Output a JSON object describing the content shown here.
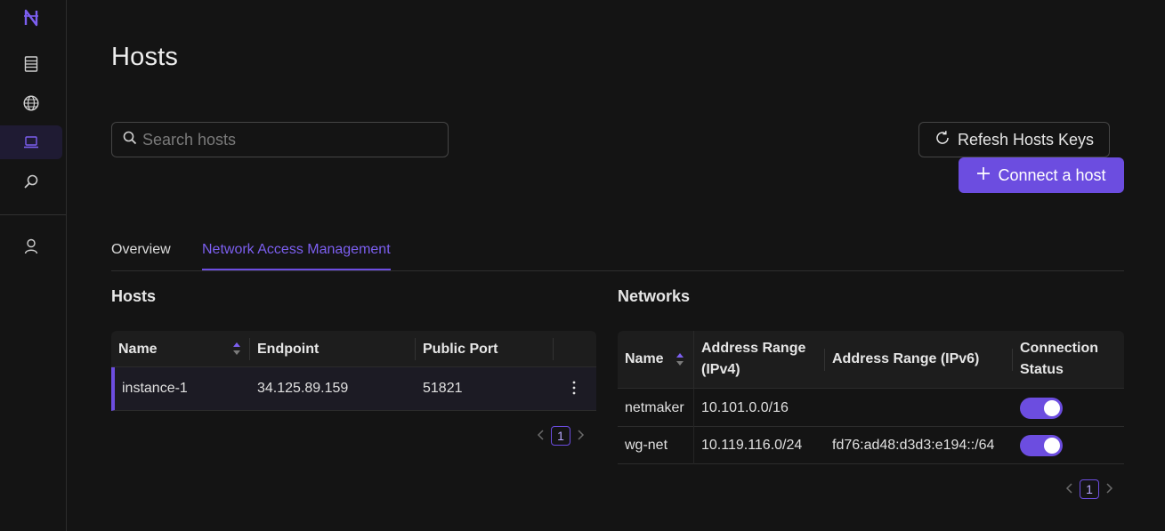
{
  "sidebar": {
    "logo": "netmaker-logo-icon",
    "items": [
      {
        "name": "networks",
        "icon": "server-icon"
      },
      {
        "name": "globe",
        "icon": "globe-icon"
      },
      {
        "name": "hosts",
        "icon": "laptop-icon",
        "active": true
      },
      {
        "name": "search",
        "icon": "search-icon"
      },
      {
        "name": "user",
        "icon": "user-icon"
      }
    ]
  },
  "page": {
    "title": "Hosts"
  },
  "search": {
    "placeholder": "Search hosts",
    "value": ""
  },
  "buttons": {
    "refresh_label": "Refesh Hosts Keys",
    "connect_label": "Connect a host"
  },
  "tabs": [
    {
      "label": "Overview",
      "active": false
    },
    {
      "label": "Network Access Management",
      "active": true
    }
  ],
  "hosts_section": {
    "title": "Hosts",
    "columns": [
      "Name",
      "Endpoint",
      "Public Port"
    ],
    "rows": [
      {
        "name": "instance-1",
        "endpoint": "34.125.89.159",
        "port": "51821"
      }
    ],
    "page": "1"
  },
  "networks_section": {
    "title": "Networks",
    "columns": {
      "name": "Name",
      "ipv4_line1": "Address Range",
      "ipv4_line2": "(IPv4)",
      "ipv6": "Address Range (IPv6)",
      "status_line1": "Connection",
      "status_line2": "Status"
    },
    "rows": [
      {
        "name": "netmaker",
        "ipv4": "10.101.0.0/16",
        "ipv6": "",
        "connected": true
      },
      {
        "name": "wg-net",
        "ipv4": "10.119.116.0/24",
        "ipv6": "fd76:ad48:d3d3:e194::/64",
        "connected": true
      }
    ],
    "page": "1"
  },
  "colors": {
    "accent": "#6c4de0",
    "background": "#141414"
  }
}
